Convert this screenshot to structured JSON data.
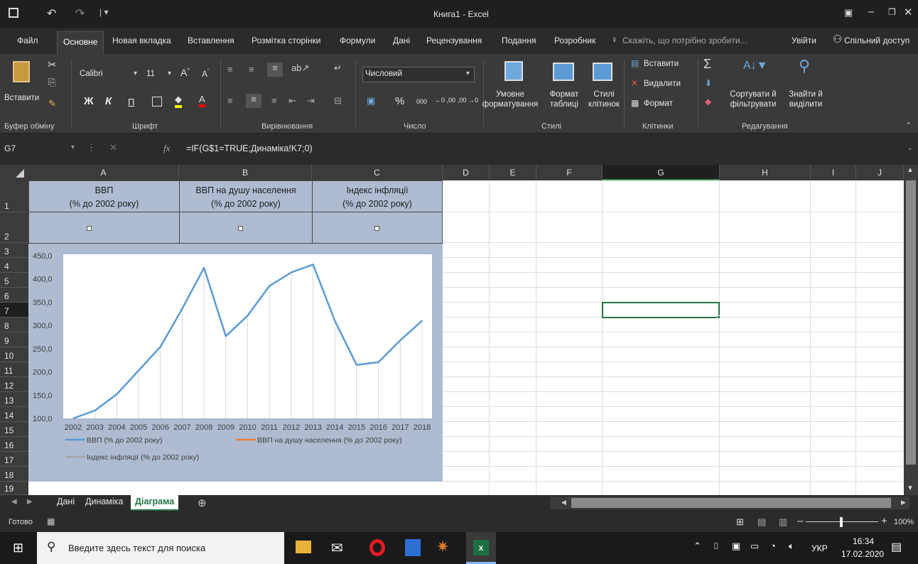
{
  "window": {
    "title": "Книга1 - Excel"
  },
  "menu": {
    "tabs": [
      "Файл",
      "Основне",
      "Новая вкладка",
      "Вставлення",
      "Розмітка сторінки",
      "Формули",
      "Дані",
      "Рецензування",
      "Подання",
      "Розробник"
    ],
    "tell_me": "Скажіть, що потрібно зробити...",
    "signin": "Увійти",
    "share": "Спільний доступ"
  },
  "ribbon": {
    "paste_label": "Вставити",
    "font_name": "Calibri",
    "font_size": "11",
    "bold": "Ж",
    "italic": "К",
    "underline": "П",
    "number_format": "Числовий",
    "percent": "%",
    "thousands": "000",
    "inc_dec": "←0 ,00",
    "dec_dec": ",00 →0",
    "cond_format": "Умовне форматування",
    "format_table": "Формат таблиці",
    "cell_styles": "Стилі клітинок",
    "insert": "Вставити",
    "delete": "Видалити",
    "format": "Формат",
    "sort_filter": "Сортувати й фільтрувати",
    "find_select": "Знайти й виділити",
    "groups": [
      "Буфер обміну",
      "Шрифт",
      "Вирівнювання",
      "Число",
      "Стилі",
      "Клітинки",
      "Редагування"
    ]
  },
  "formula_bar": {
    "name_box": "G7",
    "fx": "fx",
    "formula": "=IF(G$1=TRUE;Динаміка!K7;0)"
  },
  "grid": {
    "columns": [
      "A",
      "B",
      "C",
      "D",
      "E",
      "F",
      "G",
      "H",
      "I",
      "J"
    ],
    "rows": [
      "1",
      "2",
      "3",
      "4",
      "5",
      "6",
      "7",
      "8",
      "9",
      "10",
      "11",
      "12",
      "13",
      "14",
      "15",
      "16",
      "17",
      "18",
      "19"
    ],
    "header_cells": [
      "ВВП\n(% до 2002 року)",
      "ВВП на душу населення\n(% до 2002 року)",
      "Індекс інфляції\n(% до 2002 року)"
    ]
  },
  "chart_data": {
    "type": "line",
    "categories": [
      "2002",
      "2003",
      "2004",
      "2005",
      "2006",
      "2007",
      "2008",
      "2009",
      "2010",
      "2011",
      "2012",
      "2013",
      "2014",
      "2015",
      "2016",
      "2017",
      "2018"
    ],
    "series": [
      {
        "name": "ВВП (% до 2002 року)",
        "color": "#5b9bd5",
        "values": [
          100.0,
          117.0,
          152.0,
          203.0,
          254.0,
          336.0,
          424.0,
          277.0,
          321.0,
          385.0,
          414.0,
          431.0,
          310.0,
          215.0,
          221.0,
          268.0,
          310.0
        ]
      },
      {
        "name": "ВВП на душу населення (% до 2002 року)",
        "color": "#ed7d31",
        "values": []
      },
      {
        "name": "Індекс інфляції (% до 2002 року)",
        "color": "#a5a5a5",
        "values": []
      }
    ],
    "yticks": [
      "100,0",
      "150,0",
      "200,0",
      "250,0",
      "300,0",
      "350,0",
      "400,0",
      "450,0"
    ],
    "ylim": [
      100,
      450
    ],
    "grid": false,
    "legend": "bottom"
  },
  "sheets": {
    "tabs": [
      "Дані",
      "Динаміка",
      "Діаграма"
    ],
    "active": "Діаграма"
  },
  "status": {
    "ready": "Готово",
    "zoom": "100%"
  },
  "taskbar": {
    "search": "Введите здесь текст для поиска",
    "lang": "УКР",
    "time": "16:34",
    "date": "17.02.2020"
  }
}
